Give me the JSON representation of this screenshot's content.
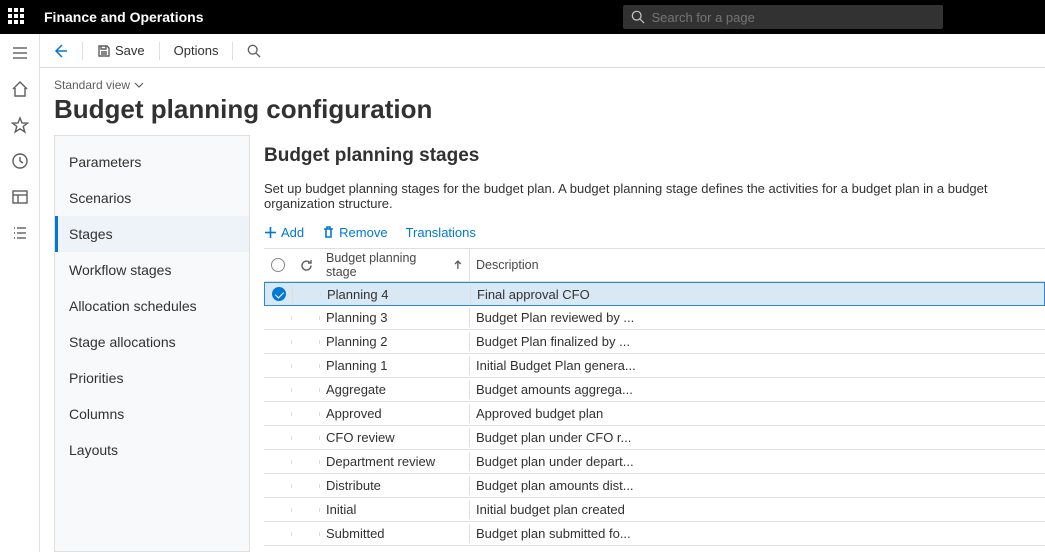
{
  "header": {
    "brand": "Finance and Operations",
    "search_placeholder": "Search for a page"
  },
  "actionbar": {
    "save": "Save",
    "options": "Options"
  },
  "page": {
    "view_label": "Standard view",
    "title": "Budget planning configuration"
  },
  "sidemenu": [
    {
      "label": "Parameters",
      "active": false
    },
    {
      "label": "Scenarios",
      "active": false
    },
    {
      "label": "Stages",
      "active": true
    },
    {
      "label": "Workflow stages",
      "active": false
    },
    {
      "label": "Allocation schedules",
      "active": false
    },
    {
      "label": "Stage allocations",
      "active": false
    },
    {
      "label": "Priorities",
      "active": false
    },
    {
      "label": "Columns",
      "active": false
    },
    {
      "label": "Layouts",
      "active": false
    }
  ],
  "pane": {
    "title": "Budget planning stages",
    "description": "Set up budget planning stages for the budget plan. A budget planning stage defines the activities for a budget plan in a budget organization structure.",
    "toolbar": {
      "add": "Add",
      "remove": "Remove",
      "translations": "Translations"
    },
    "columns": {
      "stage": "Budget planning stage",
      "description": "Description"
    },
    "rows": [
      {
        "selected": true,
        "stage": "Planning 4",
        "description": "Final approval CFO"
      },
      {
        "selected": false,
        "stage": "Planning 3",
        "description": "Budget Plan reviewed by ..."
      },
      {
        "selected": false,
        "stage": "Planning 2",
        "description": "Budget Plan finalized by ..."
      },
      {
        "selected": false,
        "stage": "Planning 1",
        "description": "Initial Budget Plan genera..."
      },
      {
        "selected": false,
        "stage": "Aggregate",
        "description": "Budget amounts aggrega..."
      },
      {
        "selected": false,
        "stage": "Approved",
        "description": "Approved budget plan"
      },
      {
        "selected": false,
        "stage": "CFO review",
        "description": "Budget plan under CFO r..."
      },
      {
        "selected": false,
        "stage": "Department review",
        "description": "Budget plan under depart..."
      },
      {
        "selected": false,
        "stage": "Distribute",
        "description": "Budget plan amounts dist..."
      },
      {
        "selected": false,
        "stage": "Initial",
        "description": "Initial budget plan created"
      },
      {
        "selected": false,
        "stage": "Submitted",
        "description": "Budget plan submitted fo..."
      }
    ]
  }
}
